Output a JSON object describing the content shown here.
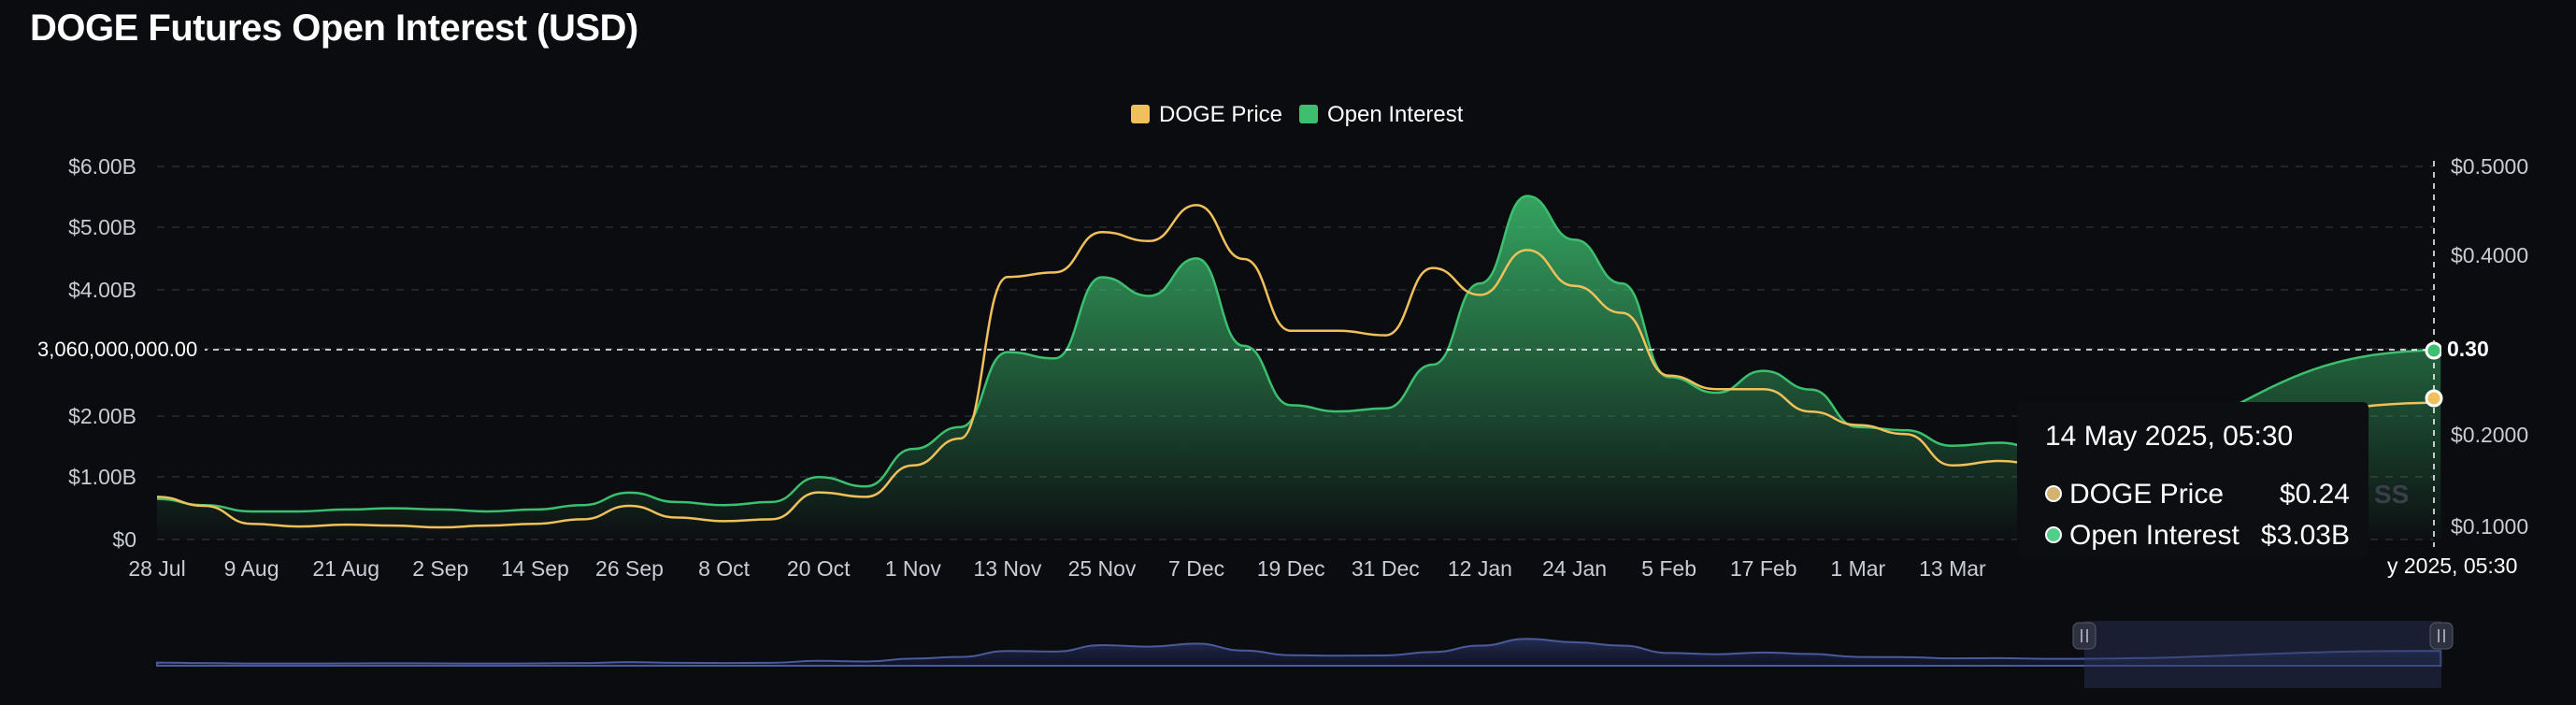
{
  "title": "DOGE Futures Open Interest (USD)",
  "colors": {
    "price": "#f0c05a",
    "open_interest": "#3cbf6e",
    "navigator": "#4a5a9a",
    "background": "#0b0c10"
  },
  "chart_data": {
    "type": "area",
    "title": "DOGE Futures Open Interest (USD)",
    "legend": [
      "DOGE Price",
      "Open Interest"
    ],
    "legend_position": "top-center",
    "grid": true,
    "x_tick_labels": [
      "28 Jul",
      "9 Aug",
      "21 Aug",
      "2 Sep",
      "14 Sep",
      "26 Sep",
      "8 Oct",
      "20 Oct",
      "1 Nov",
      "13 Nov",
      "25 Nov",
      "7 Dec",
      "19 Dec",
      "31 Dec",
      "12 Jan",
      "24 Jan",
      "5 Feb",
      "17 Feb",
      "1 Mar",
      "13 Mar"
    ],
    "y_left_ticks": [
      "$0",
      "$1.00B",
      "$2.00B",
      "$4.00B",
      "$5.00B",
      "$6.00B"
    ],
    "y_left_range": [
      0,
      6000000000
    ],
    "y_right_ticks": [
      "$0.1000",
      "$0.2000",
      "$0.4000",
      "$0.5000"
    ],
    "y_right_range": [
      0.1,
      0.5
    ],
    "series": [
      {
        "name": "Open Interest",
        "axis": "left",
        "unit": "USD",
        "points": [
          [
            "28 Jul",
            650000000.0
          ],
          [
            "3 Aug",
            550000000.0
          ],
          [
            "9 Aug",
            450000000.0
          ],
          [
            "15 Aug",
            450000000.0
          ],
          [
            "21 Aug",
            480000000.0
          ],
          [
            "27 Aug",
            500000000.0
          ],
          [
            "2 Sep",
            480000000.0
          ],
          [
            "8 Sep",
            450000000.0
          ],
          [
            "14 Sep",
            480000000.0
          ],
          [
            "20 Sep",
            550000000.0
          ],
          [
            "26 Sep",
            750000000.0
          ],
          [
            "2 Oct",
            600000000.0
          ],
          [
            "8 Oct",
            550000000.0
          ],
          [
            "14 Oct",
            600000000.0
          ],
          [
            "20 Oct",
            1000000000.0
          ],
          [
            "26 Oct",
            850000000.0
          ],
          [
            "1 Nov",
            1450000000.0
          ],
          [
            "7 Nov",
            1800000000.0
          ],
          [
            "13 Nov",
            3000000000.0
          ],
          [
            "19 Nov",
            2900000000.0
          ],
          [
            "25 Nov",
            4200000000.0
          ],
          [
            "1 Dec",
            3900000000.0
          ],
          [
            "7 Dec",
            4500000000.0
          ],
          [
            "13 Dec",
            3100000000.0
          ],
          [
            "19 Dec",
            2150000000.0
          ],
          [
            "25 Dec",
            2050000000.0
          ],
          [
            "31 Dec",
            2100000000.0
          ],
          [
            "6 Jan",
            2800000000.0
          ],
          [
            "12 Jan",
            4100000000.0
          ],
          [
            "18 Jan",
            5500000000.0
          ],
          [
            "24 Jan",
            4800000000.0
          ],
          [
            "30 Jan",
            4100000000.0
          ],
          [
            "5 Feb",
            2600000000.0
          ],
          [
            "11 Feb",
            2350000000.0
          ],
          [
            "17 Feb",
            2700000000.0
          ],
          [
            "23 Feb",
            2400000000.0
          ],
          [
            "1 Mar",
            1800000000.0
          ],
          [
            "7 Mar",
            1750000000.0
          ],
          [
            "13 Mar",
            1500000000.0
          ],
          [
            "19 Mar",
            1550000000.0
          ],
          [
            "25 Mar",
            1400000000.0
          ],
          [
            "14 May",
            3030000000.0
          ]
        ]
      },
      {
        "name": "DOGE Price",
        "axis": "right",
        "unit": "USD",
        "points": [
          [
            "28 Jul",
            0.135
          ],
          [
            "3 Aug",
            0.125
          ],
          [
            "9 Aug",
            0.105
          ],
          [
            "15 Aug",
            0.102
          ],
          [
            "21 Aug",
            0.104
          ],
          [
            "27 Aug",
            0.103
          ],
          [
            "2 Sep",
            0.101
          ],
          [
            "8 Sep",
            0.103
          ],
          [
            "14 Sep",
            0.105
          ],
          [
            "20 Sep",
            0.11
          ],
          [
            "26 Sep",
            0.125
          ],
          [
            "2 Oct",
            0.112
          ],
          [
            "8 Oct",
            0.108
          ],
          [
            "14 Oct",
            0.11
          ],
          [
            "20 Oct",
            0.14
          ],
          [
            "26 Oct",
            0.135
          ],
          [
            "1 Nov",
            0.17
          ],
          [
            "7 Nov",
            0.2
          ],
          [
            "13 Nov",
            0.38
          ],
          [
            "19 Nov",
            0.385
          ],
          [
            "25 Nov",
            0.43
          ],
          [
            "1 Dec",
            0.42
          ],
          [
            "7 Dec",
            0.46
          ],
          [
            "13 Dec",
            0.4
          ],
          [
            "19 Dec",
            0.32
          ],
          [
            "25 Dec",
            0.32
          ],
          [
            "31 Dec",
            0.315
          ],
          [
            "6 Jan",
            0.39
          ],
          [
            "12 Jan",
            0.36
          ],
          [
            "18 Jan",
            0.41
          ],
          [
            "24 Jan",
            0.37
          ],
          [
            "30 Jan",
            0.34
          ],
          [
            "5 Feb",
            0.27
          ],
          [
            "11 Feb",
            0.255
          ],
          [
            "17 Feb",
            0.255
          ],
          [
            "23 Feb",
            0.23
          ],
          [
            "1 Mar",
            0.215
          ],
          [
            "7 Mar",
            0.205
          ],
          [
            "13 Mar",
            0.17
          ],
          [
            "19 Mar",
            0.175
          ],
          [
            "25 Mar",
            0.17
          ],
          [
            "14 May",
            0.24
          ]
        ]
      }
    ],
    "crosshair": {
      "left_value_label": "3,060,000,000.00",
      "right_value_label": "0.30",
      "date_label": "y 2025, 05:30"
    },
    "tooltip": {
      "title": "14 May 2025, 05:30",
      "rows": [
        {
          "label": "DOGE Price",
          "value": "$0.24"
        },
        {
          "label": "Open Interest",
          "value": "$3.03B"
        }
      ]
    },
    "watermark": "SS"
  }
}
